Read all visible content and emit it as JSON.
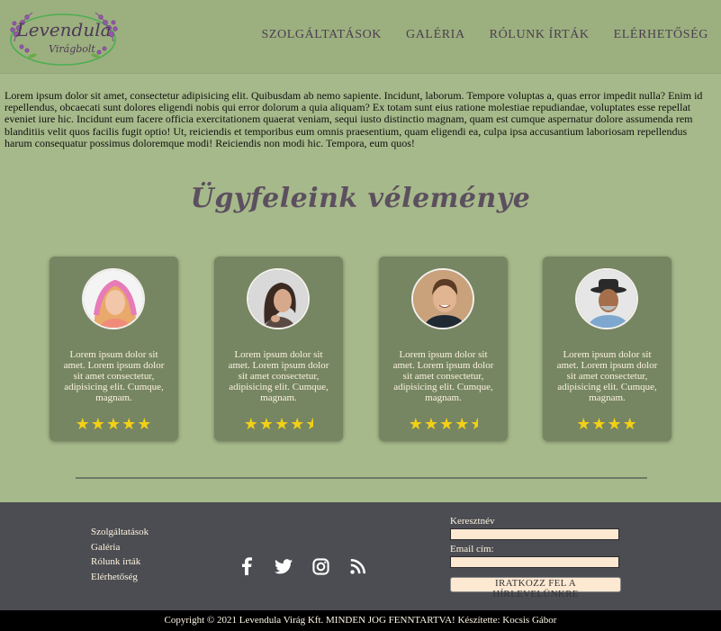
{
  "brand": {
    "logo_line1": "Levendula",
    "logo_line2": "Virágbolt"
  },
  "nav": [
    {
      "label": "SZOLGÁLTATÁSOK"
    },
    {
      "label": "GALÉRIA"
    },
    {
      "label": "RÓLUNK ÍRTÁK"
    },
    {
      "label": "ELÉRHETŐSÉG"
    }
  ],
  "intro": "Lorem ipsum dolor sit amet, consectetur adipisicing elit. Quibusdam ab nemo sapiente. Incidunt, laborum. Tempore voluptas a, quas error impedit nulla? Enim id repellendus, obcaecati sunt dolores eligendi nobis qui error dolorum a quia aliquam? Ex totam sunt eius ratione molestiae repudiandae, voluptates esse repellat eveniet iure hic. Incidunt eum facere officia exercitationem quaerat veniam, sequi iusto distinctio magnam, quam est cumque aspernatur dolore assumenda rem blanditiis velit quos facilis fugit optio! Ut, reiciendis et temporibus eum omnis praesentium, quam eligendi ea, culpa ipsa accusantium laboriosam repellendus harum consequatur possimus doloremque modi! Reiciendis non modi hic. Tempora, eum quos!",
  "testimonials": {
    "title": "Ügyfeleink véleménye",
    "cards": [
      {
        "text": "Lorem ipsum dolor sit amet. Lorem ipsum dolor sit amet consectetur, adipisicing elit. Cumque, magnam.",
        "rating": 5
      },
      {
        "text": "Lorem ipsum dolor sit amet. Lorem ipsum dolor sit amet consectetur, adipisicing elit. Cumque, magnam.",
        "rating": 4.5
      },
      {
        "text": "Lorem ipsum dolor sit amet. Lorem ipsum dolor sit amet consectetur, adipisicing elit. Cumque, magnam.",
        "rating": 4.5
      },
      {
        "text": "Lorem ipsum dolor sit amet. Lorem ipsum dolor sit amet consectetur, adipisicing elit. Cumque, magnam.",
        "rating": 4
      }
    ]
  },
  "footer": {
    "links": [
      "Szolgáltatások",
      "Galéria",
      "Rólunk írták",
      "Elérhetőség"
    ],
    "social_icons": [
      "facebook-icon",
      "twitter-icon",
      "instagram-icon",
      "rss-icon"
    ],
    "form": {
      "first_name_label": "Keresztnév",
      "first_name_value": "",
      "email_label": "Email cím:",
      "email_value": "",
      "submit_label": "IRATKOZZ FEL A HÍRLEVELÜNKRE"
    }
  },
  "copyright": "Copyright © 2021 Levendula Virág Kft. MINDEN JOG FENNTARTVA! Készítette: Kocsis Gábor",
  "colors": {
    "page_bg": "#a6b98a",
    "header_bg": "#9caf7f",
    "card_bg": "#768562",
    "footer_bg": "#4b4d52",
    "star": "#f2d016",
    "accent_text": "#5c4f5f"
  }
}
